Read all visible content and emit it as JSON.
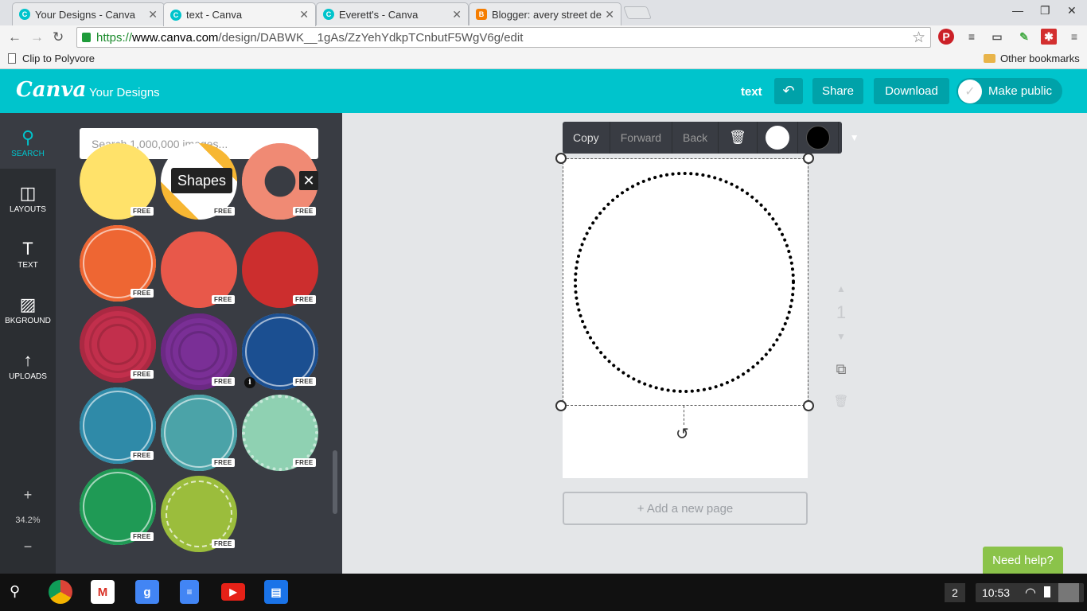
{
  "browser": {
    "tabs": [
      {
        "title": "Your Designs - Canva",
        "icon": "canva-icon",
        "active": false
      },
      {
        "title": "text - Canva",
        "icon": "canva-icon",
        "active": true
      },
      {
        "title": "Everett's - Canva",
        "icon": "canva-icon",
        "active": false
      },
      {
        "title": "Blogger: avery street des",
        "icon": "blogger-icon",
        "active": false
      }
    ],
    "url": {
      "scheme": "https://",
      "domain": "www.canva.com",
      "path": "/design/DABWK__1gAs/ZzYehYdkpTCnbutF5WgV6g/edit"
    },
    "bookmarks": {
      "left": "Clip to Polyvore",
      "right": "Other bookmarks"
    }
  },
  "header": {
    "logo": "Canva",
    "your_designs": "Your Designs",
    "design_name": "text",
    "share": "Share",
    "download": "Download",
    "make_public": "Make public",
    "accent": "#00c4cc"
  },
  "rail": {
    "items": [
      {
        "label": "SEARCH",
        "icon": "search-icon"
      },
      {
        "label": "LAYOUTS",
        "icon": "layouts-icon"
      },
      {
        "label": "TEXT",
        "icon": "text-icon"
      },
      {
        "label": "BKGROUND",
        "icon": "background-icon"
      },
      {
        "label": "UPLOADS",
        "icon": "upload-icon"
      }
    ],
    "zoom": "34.2%",
    "zoom_in": "+",
    "zoom_out": "−"
  },
  "panel": {
    "search_placeholder": "Search 1,000,000 images...",
    "tooltip": "Shapes",
    "close": "✕",
    "info": "i",
    "free_badge": "FREE",
    "shape_colors": [
      "#ffe26a",
      "#f7b733",
      "#f08a74",
      "#ee6633",
      "#e8584a",
      "#cc2e2e",
      "#c22f4c",
      "#7a2f96",
      "#1b4f91",
      "#2f8aa8",
      "#4ba3a8",
      "#8fd1b2",
      "#1f9a55",
      "#9bbd3c"
    ]
  },
  "float_toolbar": {
    "copy": "Copy",
    "forward": "Forward",
    "back": "Back",
    "fill_white": "#ffffff",
    "fill_black": "#000000"
  },
  "editor": {
    "add_page": "+ Add a new page",
    "page_number": "1",
    "need_help": "Need help?"
  },
  "taskbar": {
    "notifications": "2",
    "time": "10:53"
  }
}
